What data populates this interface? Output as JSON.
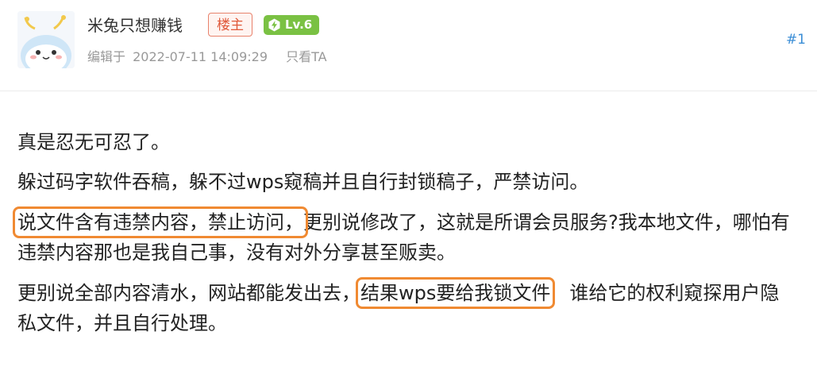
{
  "post": {
    "author_name": "米兔只想赚钱",
    "op_badge": "楼主",
    "level_badge": "Lv.6",
    "edit_label": "编辑于",
    "edit_time": "2022-07-11 14:09:29",
    "only_author_link": "只看TA",
    "floor": "#1"
  },
  "body": {
    "p1": "真是忍无可忍了。",
    "p2": "躲过码字软件吞稿，躲不过wps窥稿并且自行封锁稿子，严禁访问。",
    "p3_highlight": "说文件含有违禁内容，禁止访问，",
    "p3_rest": "更别说修改了，这就是所谓会员服务?我本地文件，哪怕有违禁内容那也是我自己事，没有对外分享甚至贩卖。",
    "p4_pre": "更别说全部内容清水，网站都能发出去，",
    "p4_highlight": "结果wps要给我锁文件",
    "p4_rest": "　谁给它的权利窥探用户隐私文件，并且自行处理。"
  },
  "colors": {
    "highlight_border": "#f08a32",
    "level_badge_bg": "#7ac143",
    "op_badge_text": "#e0593a",
    "floor_link": "#3b8ed6"
  },
  "icons": {
    "avatar": "cartoon-rabbit-avatar",
    "level": "lightning-bolt-icon"
  }
}
